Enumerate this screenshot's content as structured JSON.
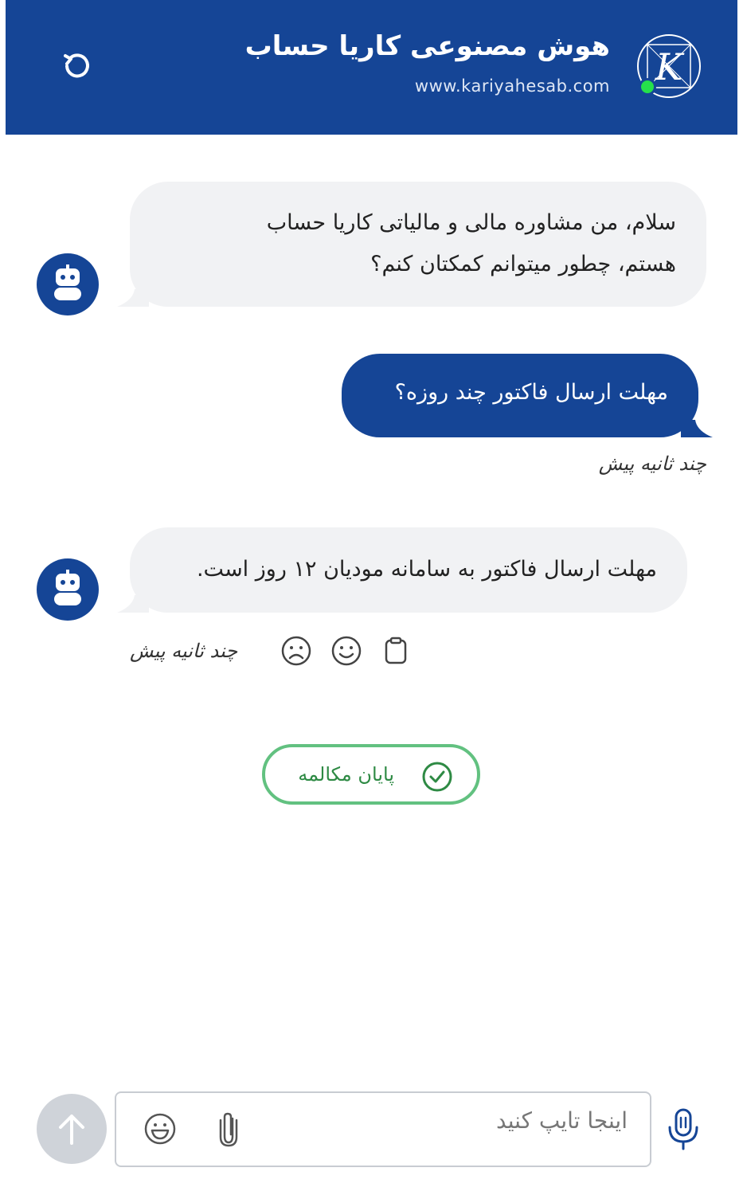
{
  "header": {
    "title": "هوش مصنوعی کاریا حساب",
    "website": "www.kariyahesab.com",
    "logo_letter": "K",
    "online_status_color": "#25e04b",
    "brand_color": "#154596"
  },
  "messages": [
    {
      "sender": "bot",
      "lines": [
        "سلام، من مشاوره مالی و مالیاتی کاریا حساب",
        "هستم، چطور میتوانم کمکتان کنم؟"
      ]
    },
    {
      "sender": "user",
      "text": "مهلت ارسال فاکتور چند روزه؟",
      "time": "چند ثانیه پیش"
    },
    {
      "sender": "bot",
      "text": "مهلت ارسال فاکتور به سامانه مودیان ۱۲ روز است.",
      "time": "چند ثانیه پیش",
      "feedback_icons": [
        "sad-face-icon",
        "smile-face-icon",
        "copy-icon"
      ]
    }
  ],
  "end_conversation": {
    "label": "پایان مکالمه",
    "color": "#2e8a44"
  },
  "composer": {
    "placeholder": "اینجا تایپ کنید",
    "icons": [
      "send-arrow-icon",
      "emoji-icon",
      "attachment-icon",
      "microphone-icon"
    ]
  }
}
